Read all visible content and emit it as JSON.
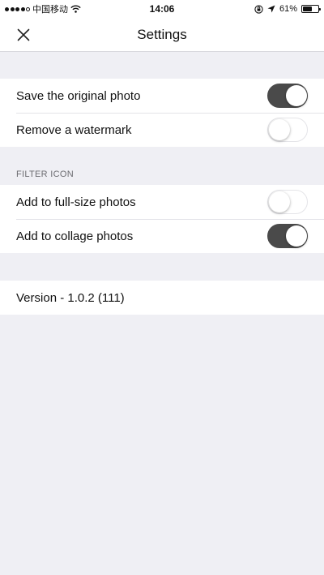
{
  "status_bar": {
    "carrier": "中国移动",
    "time": "14:06",
    "battery_percent_label": "61%",
    "battery_level": 0.61,
    "signal_bars_filled": 4,
    "signal_bars_total": 5
  },
  "nav": {
    "title": "Settings",
    "close_icon": "close-icon"
  },
  "general": {
    "items": [
      {
        "label": "Save the original photo",
        "on": true
      },
      {
        "label": "Remove a watermark",
        "on": false
      }
    ]
  },
  "filter_icon": {
    "header": "FILTER ICON",
    "items": [
      {
        "label": "Add to full-size photos",
        "on": false
      },
      {
        "label": "Add to collage photos",
        "on": true
      }
    ]
  },
  "about": {
    "version_label": "Version - 1.0.2 (111)"
  },
  "colors": {
    "toggle_on": "#4a4a4a",
    "background": "#efeff4"
  }
}
